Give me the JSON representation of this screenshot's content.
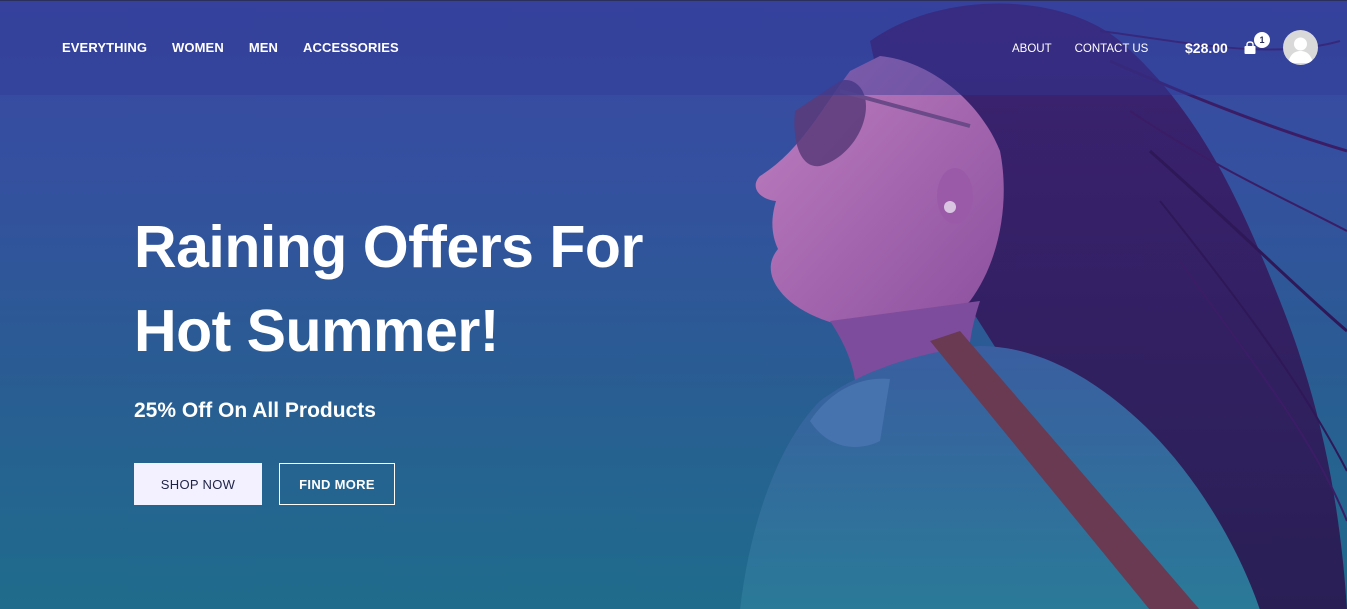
{
  "nav": {
    "left_items": [
      {
        "label": "EVERYTHING"
      },
      {
        "label": "WOMEN"
      },
      {
        "label": "MEN"
      },
      {
        "label": "ACCESSORIES"
      }
    ],
    "right_items": [
      {
        "label": "ABOUT"
      },
      {
        "label": "CONTACT US"
      }
    ],
    "cart_total": "$28.00",
    "cart_count": "1",
    "cart_icon": "shopping-bag-icon",
    "avatar_icon": "user-avatar-icon"
  },
  "hero": {
    "headline_line1": "Raining Offers For",
    "headline_line2": "Hot Summer!",
    "subheadline": "25% Off On All Products",
    "primary_button": "SHOP NOW",
    "secondary_button": "FIND MORE"
  },
  "colors": {
    "overlay_top": "#3a48a2",
    "overlay_bottom": "#1f6c8c",
    "primary_button_bg": "#f3f1ff",
    "primary_button_text": "#1e2246"
  }
}
